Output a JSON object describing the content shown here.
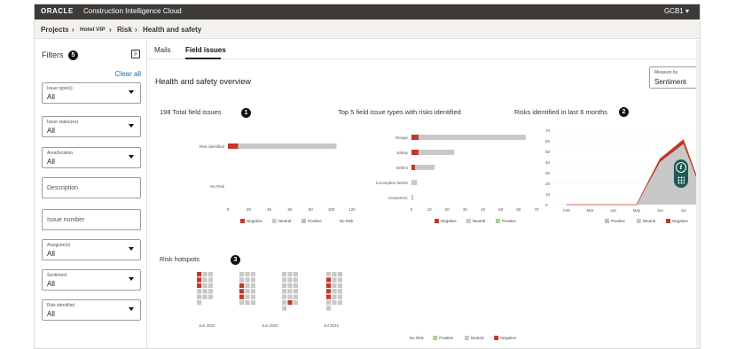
{
  "app": {
    "brand": "ORACLE",
    "product": "Construction Intelligence Cloud",
    "user": "GCB1"
  },
  "breadcrumb": [
    "Projects",
    "Hotel VIP",
    "Risk",
    "Health and safety"
  ],
  "sidebar": {
    "title": "Filters",
    "badge": "5",
    "clear_all": "Clear all",
    "filters": [
      {
        "label": "Issue type(s)",
        "value": "All",
        "type": "select"
      },
      {
        "label": "Issue status(es)",
        "value": "All",
        "type": "select"
      },
      {
        "label": "Area/location",
        "value": "All",
        "type": "select"
      },
      {
        "label": "",
        "value": "",
        "placeholder": "Description",
        "type": "text"
      },
      {
        "label": "",
        "value": "",
        "placeholder": "Issue number",
        "type": "text"
      },
      {
        "label": "Assignee(s)",
        "value": "All",
        "type": "select"
      },
      {
        "label": "Sentiment",
        "value": "All",
        "type": "select"
      },
      {
        "label": "Risk identified",
        "value": "All",
        "type": "select"
      }
    ]
  },
  "tabs": [
    {
      "label": "Mails",
      "active": false
    },
    {
      "label": "Field issues",
      "active": true
    }
  ],
  "section_title": "Health and safety overview",
  "measure": {
    "label": "Measure by",
    "value": "Sentiment"
  },
  "colors": {
    "negative": "#c0392b",
    "neutral": "#c8c8c8",
    "positive": "#a9cf9c",
    "no_risk": "#ffffff"
  },
  "chart_data": [
    {
      "type": "bar",
      "orientation": "horizontal",
      "stacked": true,
      "title": "198 Total field issues",
      "badge": "1",
      "categories": [
        "Risk identified",
        "No Risk"
      ],
      "series": [
        {
          "name": "Negative",
          "values": [
            10,
            0
          ]
        },
        {
          "name": "Neutral",
          "values": [
            95,
            0
          ]
        },
        {
          "name": "Positive",
          "values": [
            0,
            0
          ]
        },
        {
          "name": "No Risk",
          "values": [
            0,
            93
          ]
        }
      ],
      "xticks": [
        "0",
        "20",
        "40",
        "60",
        "80",
        "100",
        "120"
      ],
      "xlim": [
        0,
        120
      ]
    },
    {
      "type": "bar",
      "orientation": "horizontal",
      "stacked": true,
      "title": "Top 5 field issue types with risks identified",
      "categories": [
        "Design",
        "Safety",
        "Defect",
        "Incomplete Works",
        "CustomOC"
      ],
      "series": [
        {
          "name": "Negative",
          "values": [
            4,
            4,
            2,
            0,
            0
          ]
        },
        {
          "name": "Neutral",
          "values": [
            60,
            20,
            11,
            3,
            1
          ]
        },
        {
          "name": "Positive",
          "values": [
            0,
            0,
            0,
            0,
            0
          ]
        }
      ],
      "xticks": [
        "0",
        "10",
        "20",
        "30",
        "40",
        "50",
        "60",
        "70"
      ],
      "xlim": [
        0,
        70
      ]
    },
    {
      "type": "area",
      "stacked": true,
      "title": "Risks identified in last 6 months",
      "badge": "2",
      "x": [
        "Feb",
        "Mar",
        "Apr",
        "May",
        "Jun",
        "Jul",
        "Au"
      ],
      "series": [
        {
          "name": "Positive",
          "values": [
            0,
            0,
            0,
            0,
            0,
            0,
            0
          ]
        },
        {
          "name": "Neutral",
          "values": [
            0,
            0,
            0,
            0,
            40,
            57,
            0
          ]
        },
        {
          "name": "Negative",
          "values": [
            0,
            0,
            0,
            0,
            3,
            4,
            0
          ]
        }
      ],
      "yticks": [
        "0",
        "10",
        "20",
        "30",
        "40",
        "50",
        "60",
        "70"
      ],
      "ylim": [
        0,
        70
      ]
    },
    {
      "type": "heatmap",
      "title": "Risk hotspots",
      "badge": "3",
      "x_labels": [
        "Jun 2022",
        "Jun 2022",
        "Jul 2022"
      ],
      "legend": [
        "No Risk",
        "Positive",
        "Neutral",
        "Negative"
      ],
      "weeks": [
        {
          "cells": [
            "neg",
            "neu",
            "neu",
            "neg",
            "neu",
            "neu",
            "neg",
            "neu",
            "neu",
            "neu",
            "neu",
            "neu",
            "neu",
            "neu",
            "neu",
            "neu"
          ]
        },
        {
          "cells": [
            "neu",
            "neu",
            "neu",
            "neu",
            "neu",
            "neu",
            "neg",
            "neu",
            "neu",
            "neg",
            "neu",
            "neu",
            "neg",
            "neu",
            "neu",
            "neu",
            "neu",
            "neu"
          ]
        },
        {
          "cells": [
            "neu",
            "neu",
            "neu",
            "neu",
            "neu",
            "neu",
            "neu",
            "neu",
            "neu",
            "neu",
            "neu",
            "neu",
            "neu",
            "neu",
            "neu",
            "neu",
            "neg",
            "neu",
            "neu"
          ]
        },
        {
          "cells": [
            "neu",
            "neu",
            "neu",
            "neg",
            "neu",
            "neu",
            "neg",
            "neu",
            "neu",
            "neg",
            "neu",
            "neu",
            "neg",
            "neu",
            "neu",
            "neu",
            "neu",
            "neu",
            "neu"
          ]
        }
      ]
    }
  ]
}
